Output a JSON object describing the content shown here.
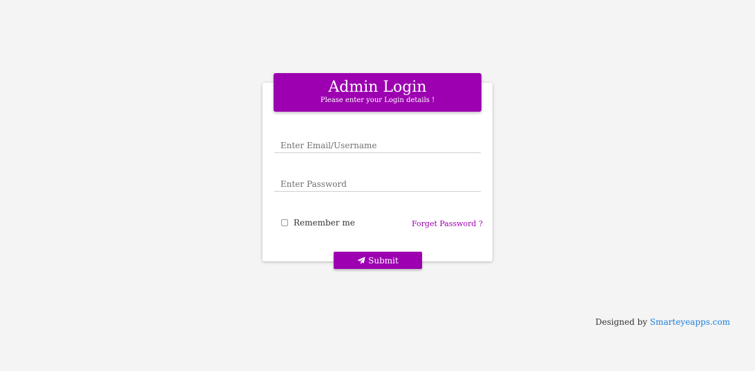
{
  "login": {
    "title": "Admin Login",
    "subtitle": "Please enter your Login details !",
    "email_placeholder": "Enter Email/Username",
    "password_placeholder": "Enter Password",
    "remember_label": "Remember me",
    "forget_label": "Forget Password ?",
    "submit_label": "Submit",
    "submit_icon": "paper-plane-icon"
  },
  "footer": {
    "prefix": "Designed by",
    "link_text": "Smarteyeapps.com"
  },
  "colors": {
    "accent": "#9c00b0",
    "link": "#1e7fd8",
    "background": "#f4f4f4"
  }
}
